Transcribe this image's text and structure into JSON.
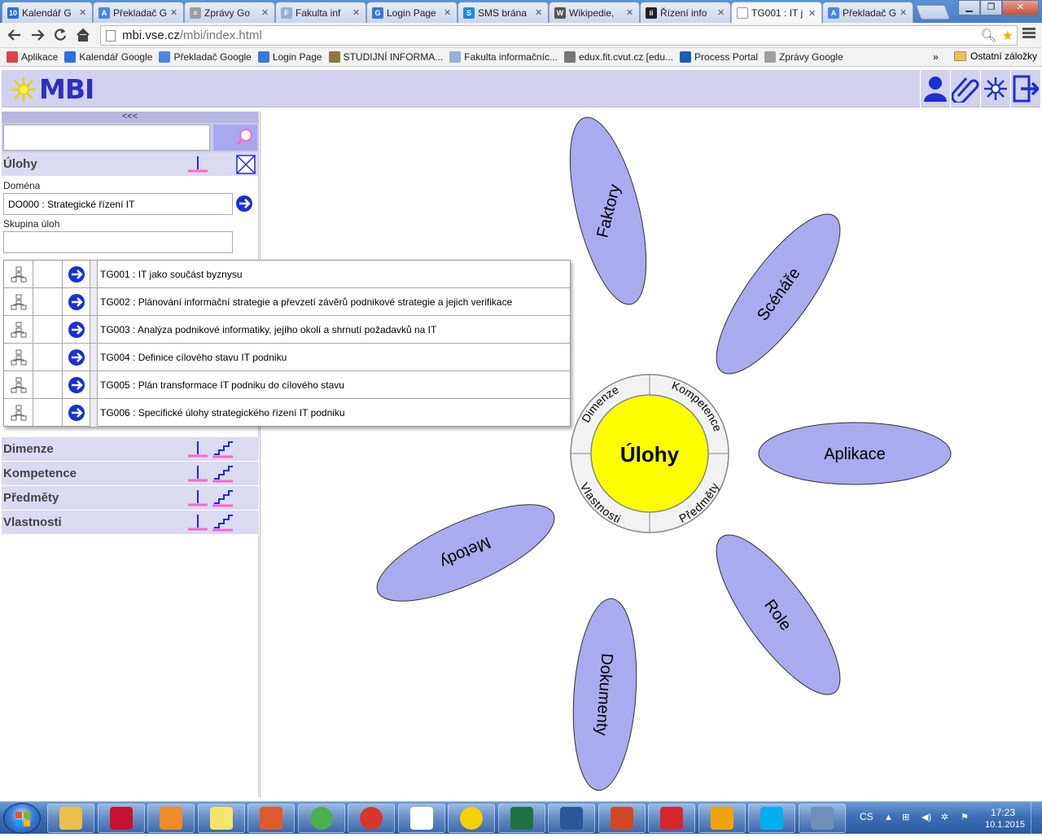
{
  "browser": {
    "tabs": [
      {
        "title": "Kalendář G",
        "icon": "calendar-icon",
        "color": "#2f6fdd",
        "glyph": "10"
      },
      {
        "title": "Překladač G",
        "icon": "translate-icon",
        "color": "#4a86e8",
        "glyph": "A"
      },
      {
        "title": "Zprávy Go",
        "icon": "news-icon",
        "color": "#9e9e9e",
        "glyph": "≡"
      },
      {
        "title": "Fakulta inf",
        "icon": "fit-icon",
        "color": "#8fb3d9",
        "glyph": "F"
      },
      {
        "title": "Login Page",
        "icon": "login-icon",
        "color": "#3b78d8",
        "glyph": "G"
      },
      {
        "title": "SMS brána",
        "icon": "sms-icon",
        "color": "#1e88e5",
        "glyph": "S"
      },
      {
        "title": "Wikipedie,",
        "icon": "wikipedia-icon",
        "color": "#555555",
        "glyph": "W"
      },
      {
        "title": "Řízení info",
        "icon": "ri-icon",
        "color": "#222222",
        "glyph": "íi"
      },
      {
        "title": "TG001 : IT j",
        "icon": "page-icon",
        "color": "#ffffff",
        "glyph": ""
      },
      {
        "title": "Překladač G",
        "icon": "translate-icon",
        "color": "#4a86e8",
        "glyph": "A"
      }
    ],
    "active_tab": 8,
    "url_host": "mbi.vse.cz",
    "url_path": "/mbi/index.html",
    "bookmarks": [
      {
        "label": "Aplikace",
        "icon": "apps-icon",
        "color": "#d44"
      },
      {
        "label": "Kalendář Google",
        "icon": "calendar-icon",
        "color": "#2f6fdd"
      },
      {
        "label": "Překladač Google",
        "icon": "translate-icon",
        "color": "#4a86e8"
      },
      {
        "label": "Login Page",
        "icon": "login-icon",
        "color": "#3b78d8"
      },
      {
        "label": "STUDIJNÍ INFORMA...",
        "icon": "study-icon",
        "color": "#8a7a3a"
      },
      {
        "label": "Fakulta informačníc...",
        "icon": "fit-icon",
        "color": "#8fb3d9"
      },
      {
        "label": "edux.fit.cvut.cz [edu...",
        "icon": "edux-icon",
        "color": "#777777"
      },
      {
        "label": "Process Portal",
        "icon": "process-icon",
        "color": "#1a5fb4"
      },
      {
        "label": "Zprávy Google",
        "icon": "news-icon",
        "color": "#9e9e9e"
      }
    ],
    "bookmarks_more": "»",
    "other_bookmarks": "Ostatní záložky"
  },
  "app": {
    "logo_text": "MBI",
    "collapse_label": "<<<",
    "search": {
      "value": "",
      "placeholder": ""
    },
    "ulohy": {
      "title": "Úlohy",
      "domain_label": "Doména",
      "domain_value": "DO000 : Strategické řízení IT",
      "group_label": "Skupina úloh",
      "group_value": ""
    },
    "sections": [
      {
        "label": "Dimenze"
      },
      {
        "label": "Kompetence"
      },
      {
        "label": "Předměty"
      },
      {
        "label": "Vlastnosti"
      }
    ],
    "popup_items": [
      "TG001 : IT jako součást byznysu",
      "TG002 : Plánování informační strategie a převzetí závěrů podnikové strategie a jejich verifikace",
      "TG003 : Analýza podnikové informatiky, jejího okolí a shrnutí požadavků na IT",
      "TG004 : Definice cílového stavu IT podniku",
      "TG005 : Plán transformace IT podniku do cílového stavu",
      "TG006 : Specifické úlohy strategického řízení IT podniku"
    ]
  },
  "flower": {
    "center": "Úlohy",
    "ring_labels": [
      "Dimenze",
      "Kompetence",
      "Předměty",
      "Vlastnosti"
    ],
    "petals": [
      "Faktory",
      "Scénáře",
      "Aplikace",
      "Role",
      "Dokumenty",
      "Metody"
    ],
    "colors": {
      "petal": "#aaaaee",
      "center": "#ffff00",
      "ring": "#f2f2f2"
    }
  },
  "taskbar": {
    "language": "CS",
    "time": "17:23",
    "date": "10.1.2015",
    "apps": [
      {
        "name": "explorer",
        "color": "#e8c04a"
      },
      {
        "name": "shield-app",
        "color": "#c8102e"
      },
      {
        "name": "media-player",
        "color": "#f08a24"
      },
      {
        "name": "sticky-notes",
        "color": "#f3e66b"
      },
      {
        "name": "paint",
        "color": "#e05a2a"
      },
      {
        "name": "chrome",
        "color": "#4caf50"
      },
      {
        "name": "help-app",
        "color": "#d9362b"
      },
      {
        "name": "tiles-app",
        "color": "#ffffff"
      },
      {
        "name": "circle-app",
        "color": "#f5d000"
      },
      {
        "name": "excel",
        "color": "#1f7244"
      },
      {
        "name": "word",
        "color": "#2b579a"
      },
      {
        "name": "powerpoint",
        "color": "#d24726"
      },
      {
        "name": "acrobat",
        "color": "#d7262e"
      },
      {
        "name": "outlook",
        "color": "#f0a30a"
      },
      {
        "name": "skype",
        "color": "#00aff0"
      },
      {
        "name": "network-app",
        "color": "#6f8fb8"
      }
    ]
  }
}
